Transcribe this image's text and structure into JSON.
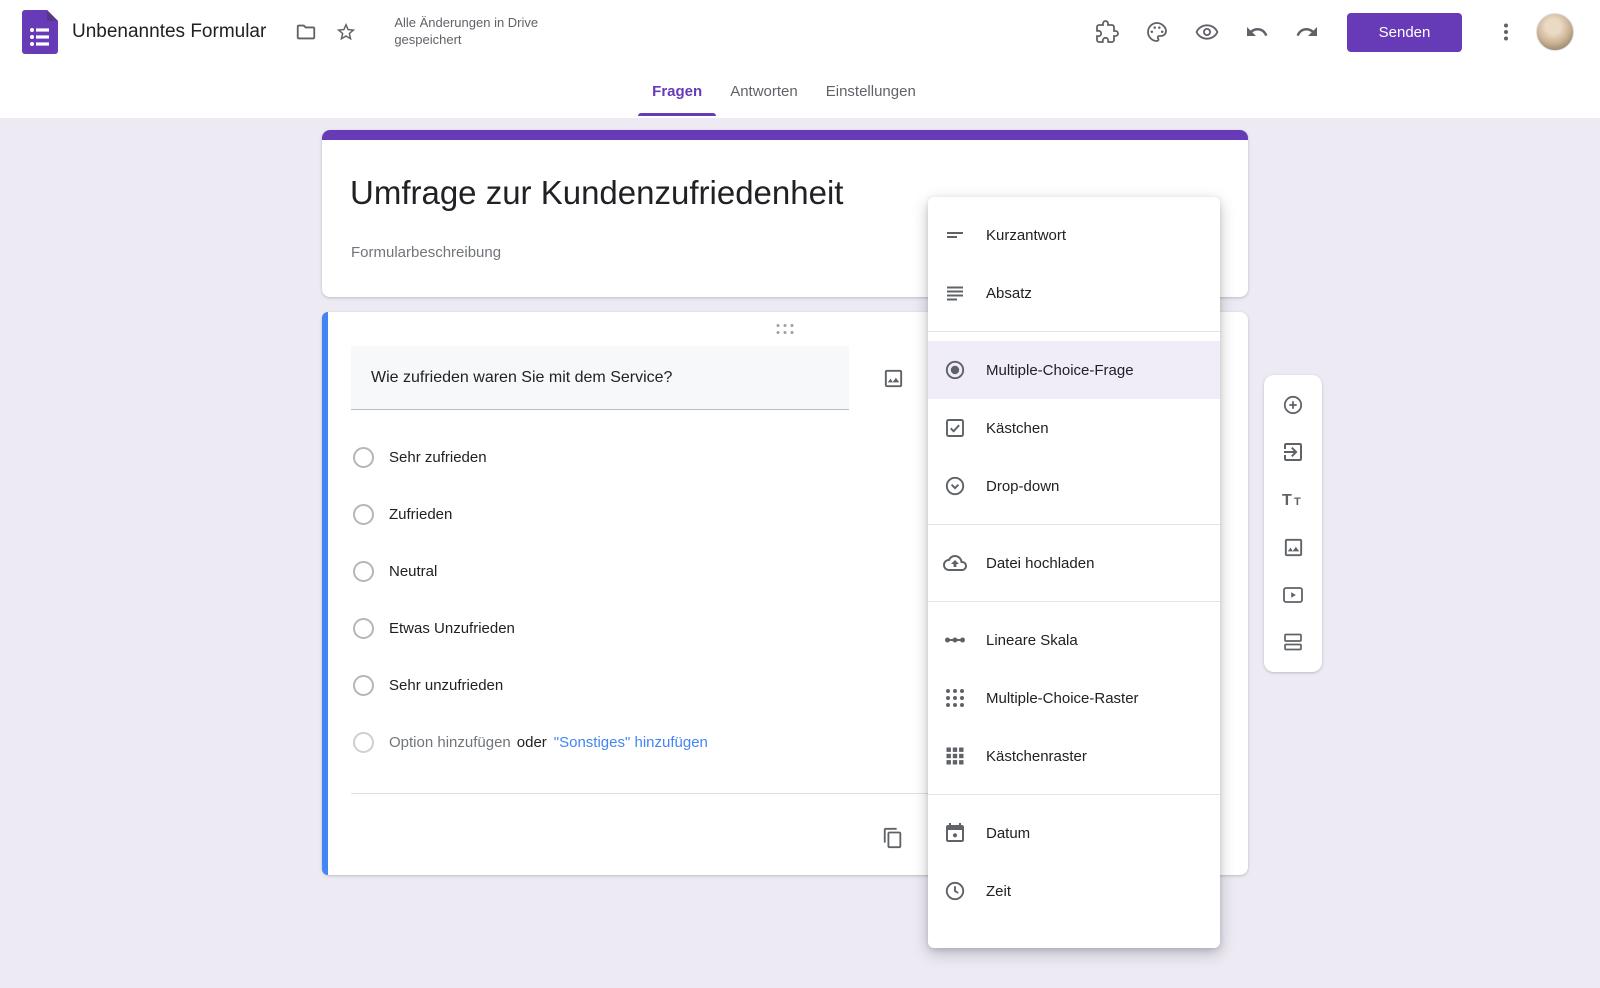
{
  "topbar": {
    "form_title": "Unbenanntes Formular",
    "save_status": "Alle Änderungen in Drive gespeichert",
    "send_button": "Senden"
  },
  "tabs": {
    "fragen": "Fragen",
    "antworten": "Antworten",
    "einstellungen": "Einstellungen"
  },
  "form_header": {
    "title": "Umfrage zur Kundenzufriedenheit",
    "description": "Formularbeschreibung"
  },
  "question": {
    "title": "Wie zufrieden waren Sie mit dem Service?",
    "options": [
      {
        "label": "Sehr zufrieden"
      },
      {
        "label": "Zufrieden"
      },
      {
        "label": "Neutral"
      },
      {
        "label": "Etwas Unzufrieden"
      },
      {
        "label": "Sehr unzufrieden"
      }
    ],
    "add_option": {
      "text": "Option hinzufügen",
      "or": "oder",
      "link": "\"Sonstiges\" hinzufügen"
    }
  },
  "type_menu": {
    "items": [
      {
        "icon": "short-answer-icon",
        "label": "Kurzantwort"
      },
      {
        "icon": "paragraph-icon",
        "label": "Absatz"
      },
      {
        "icon": "radio-checked-icon",
        "label": "Multiple-Choice-Frage",
        "selected": true
      },
      {
        "icon": "checkbox-icon",
        "label": "Kästchen"
      },
      {
        "icon": "dropdown-circle-icon",
        "label": "Drop-down"
      },
      {
        "icon": "cloud-upload-icon",
        "label": "Datei hochladen"
      },
      {
        "icon": "linear-scale-icon",
        "label": "Lineare Skala"
      },
      {
        "icon": "dot-grid-icon",
        "label": "Multiple-Choice-Raster"
      },
      {
        "icon": "square-grid-icon",
        "label": "Kästchenraster"
      },
      {
        "icon": "calendar-icon",
        "label": "Datum"
      },
      {
        "icon": "clock-icon",
        "label": "Zeit"
      }
    ]
  },
  "side_toolbar": {
    "icons": [
      "add-question-icon",
      "import-questions-icon",
      "add-title-icon",
      "add-image-icon",
      "add-video-icon",
      "add-section-icon"
    ]
  },
  "colors": {
    "accent_purple": "#673ab7",
    "question_accent_blue": "#4285f4",
    "link_blue": "#4285f4",
    "icon_gray": "#5f6368",
    "page_background": "#edeaf4",
    "selected_menu_item_bg": "#f0edf8"
  }
}
